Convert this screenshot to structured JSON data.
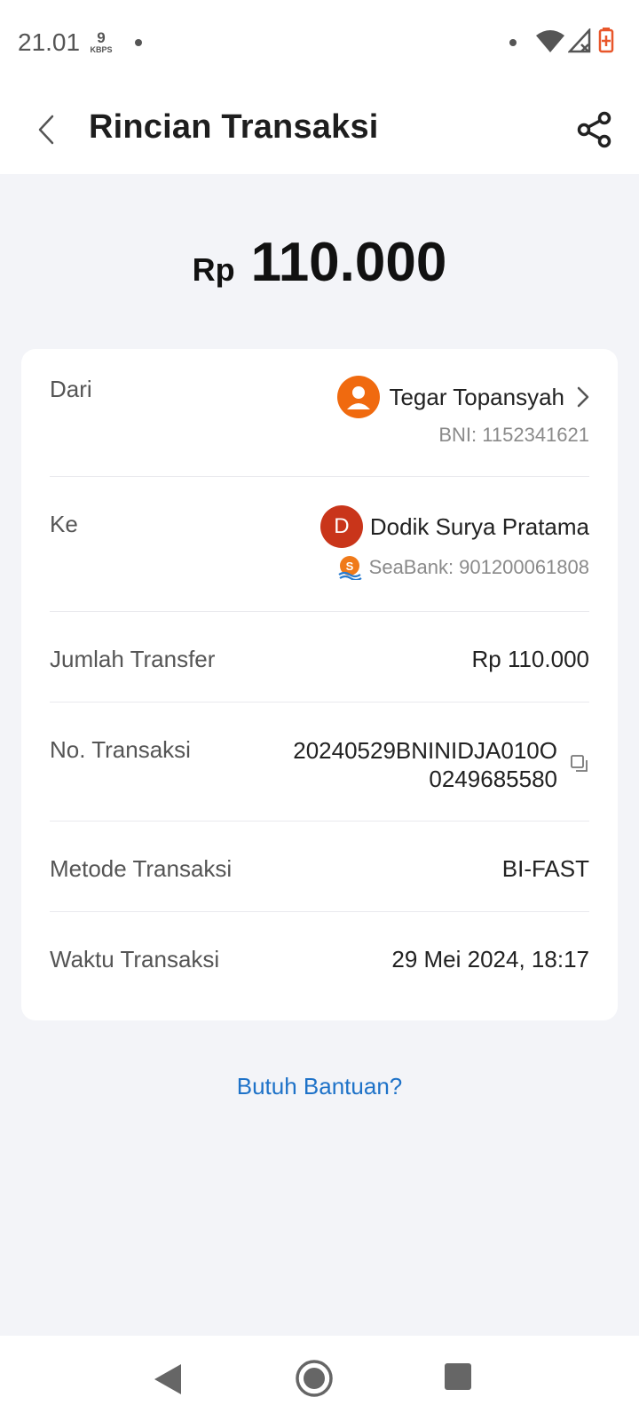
{
  "status_bar": {
    "time": "21.01",
    "speed_value": "9",
    "speed_unit": "KBPS"
  },
  "header": {
    "title": "Rincian Transaksi"
  },
  "amount": {
    "currency": "Rp",
    "value": "110.000"
  },
  "details": {
    "from": {
      "label": "Dari",
      "name": "Tegar Topansyah",
      "account": "BNI: 1152341621"
    },
    "to": {
      "label": "Ke",
      "avatar_letter": "D",
      "name": "Dodik Surya Pratama",
      "account": "SeaBank: 901200061808"
    },
    "transfer_amount": {
      "label": "Jumlah Transfer",
      "value": "Rp 110.000"
    },
    "transaction_no": {
      "label": "No. Transaksi",
      "line1": "20240529BNINIDJA010O",
      "line2": "0249685580"
    },
    "method": {
      "label": "Metode Transaksi",
      "value": "BI-FAST"
    },
    "time": {
      "label": "Waktu Transaksi",
      "value": "29 Mei 2024, 18:17"
    }
  },
  "help": {
    "label": "Butuh Bantuan?"
  },
  "colors": {
    "accent_orange": "#f06a0f",
    "avatar_red": "#c9351a",
    "link_blue": "#1e72c8",
    "background": "#f3f4f8"
  }
}
